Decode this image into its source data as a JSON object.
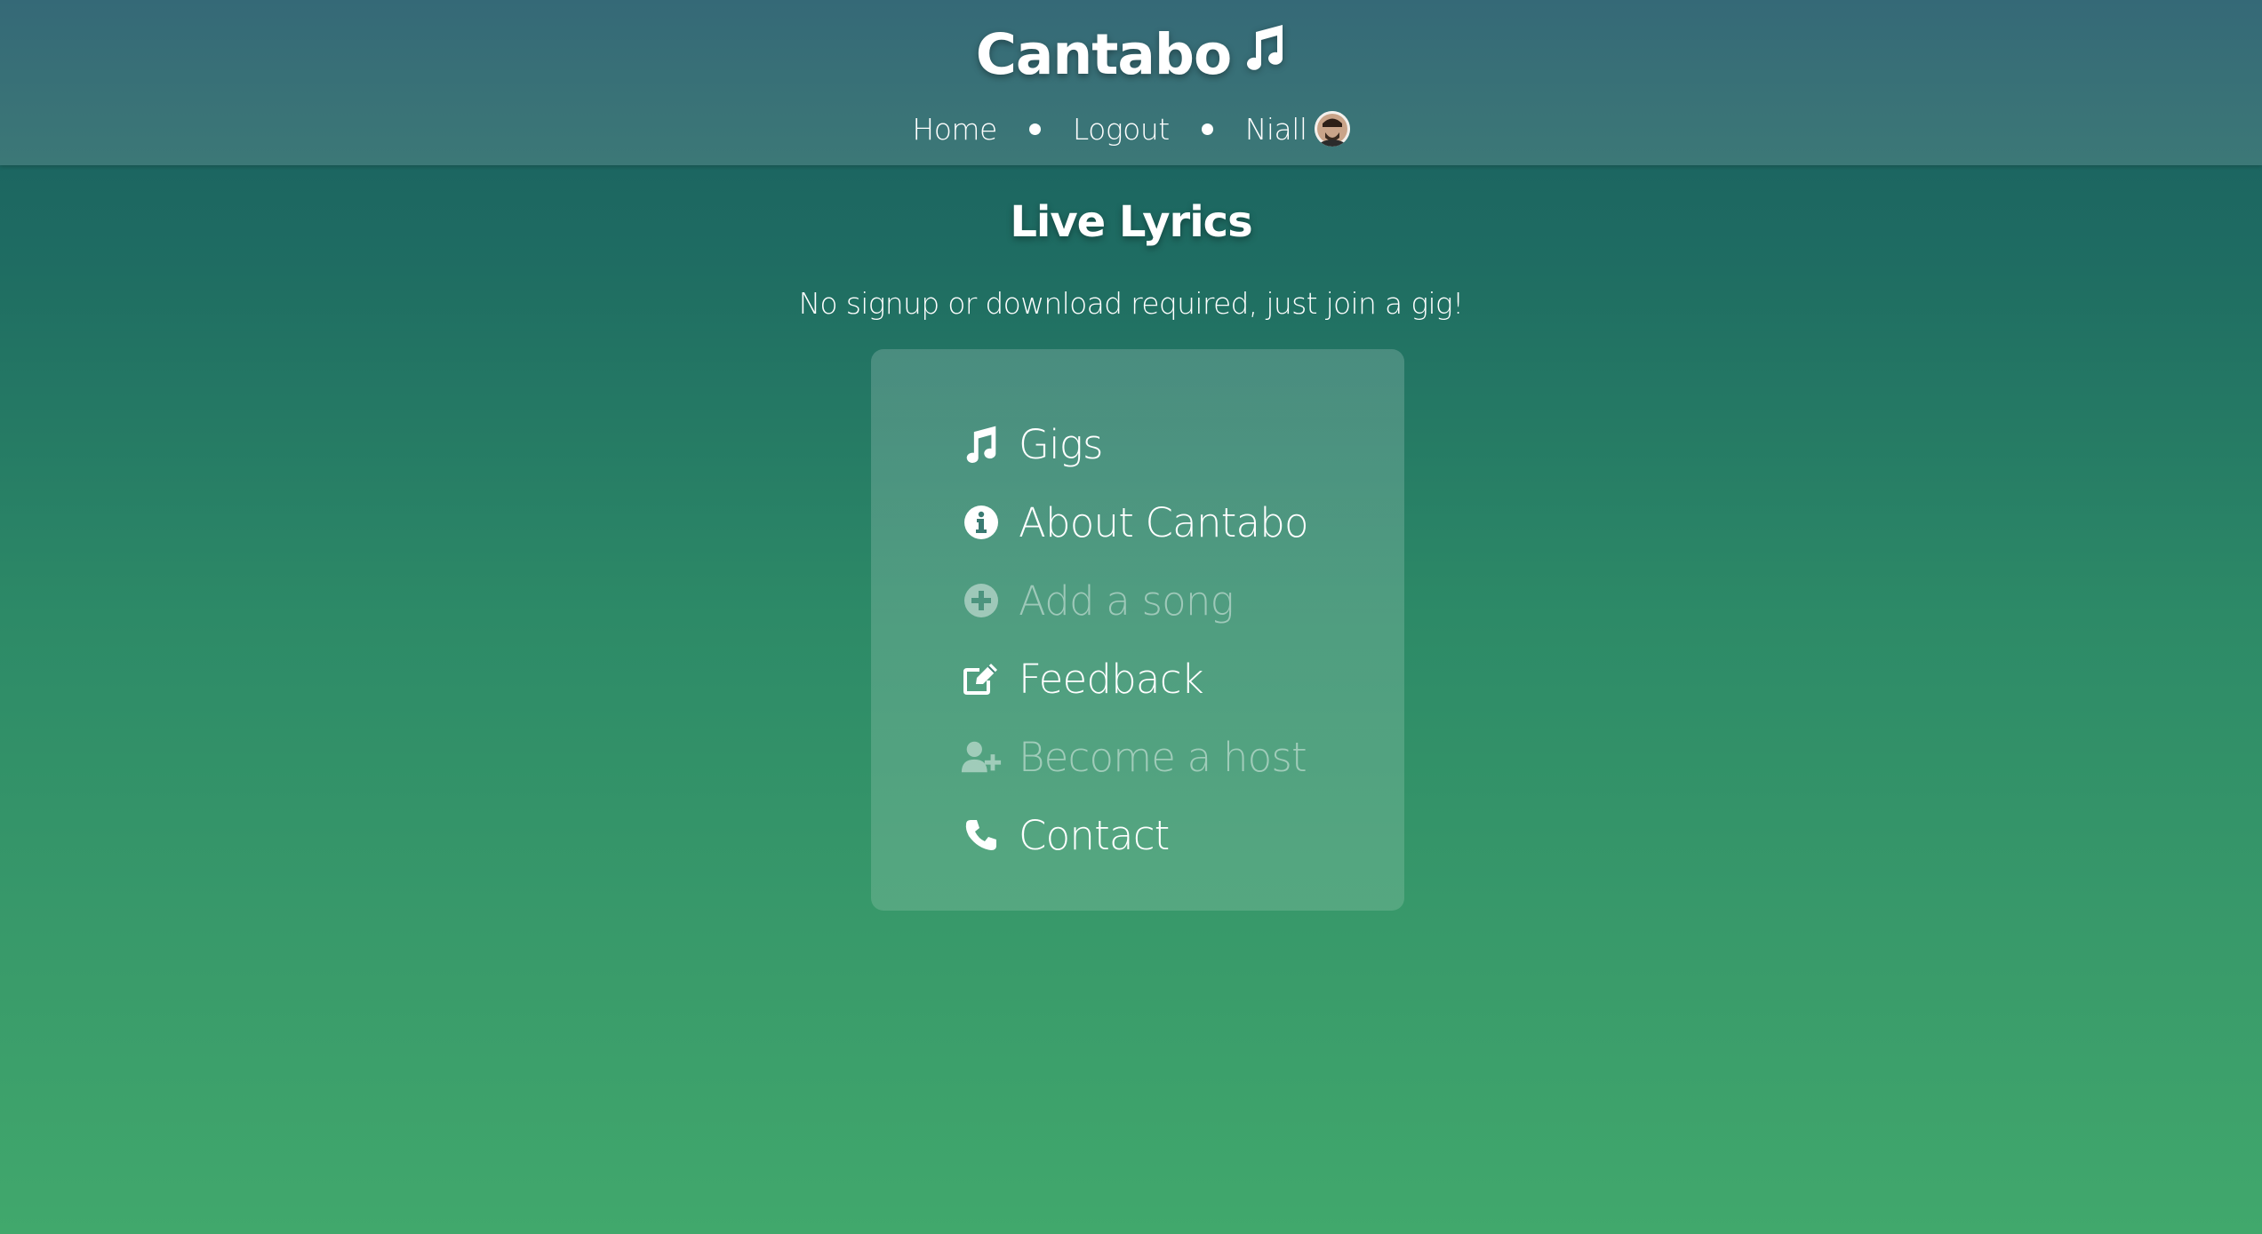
{
  "header": {
    "brand_title": "Cantabo",
    "brand_icon": "music-note-icon",
    "nav": {
      "home_label": "Home",
      "logout_label": "Logout",
      "user_name": "Niall",
      "user_avatar": "avatar"
    }
  },
  "main": {
    "title": "Live Lyrics",
    "tagline": "No signup or download required, just join a gig!",
    "menu": [
      {
        "label": "Gigs",
        "icon": "music-note-icon",
        "enabled": true
      },
      {
        "label": "About Cantabo",
        "icon": "info-circle-icon",
        "enabled": true
      },
      {
        "label": "Add a song",
        "icon": "plus-circle-icon",
        "enabled": false
      },
      {
        "label": "Feedback",
        "icon": "edit-icon",
        "enabled": true
      },
      {
        "label": "Become a host",
        "icon": "user-plus-icon",
        "enabled": false
      },
      {
        "label": "Contact",
        "icon": "phone-icon",
        "enabled": true
      }
    ]
  },
  "colors": {
    "header_bg": "#356977",
    "gradient_top": "#185a5f",
    "gradient_bottom": "#41a86c",
    "text": "#ffffff"
  }
}
